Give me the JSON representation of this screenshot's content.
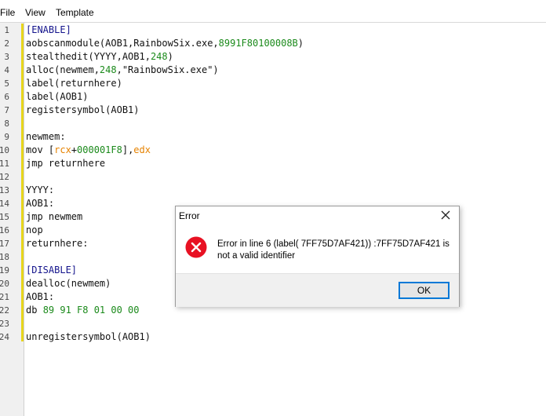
{
  "menu": {
    "file": "File",
    "view": "View",
    "template": "Template"
  },
  "editor": {
    "lines": [
      {
        "no": "1",
        "parts": [
          {
            "t": "[ENABLE]",
            "c": "sec"
          }
        ]
      },
      {
        "no": "2",
        "parts": [
          {
            "t": "aobscanmodule(AOB1,RainbowSix.exe,",
            "c": "kw"
          },
          {
            "t": "8991F80100008B",
            "c": "num"
          },
          {
            "t": ")",
            "c": "kw"
          }
        ]
      },
      {
        "no": "3",
        "parts": [
          {
            "t": "stealthedit(YYYY,AOB1,",
            "c": "kw"
          },
          {
            "t": "248",
            "c": "num"
          },
          {
            "t": ")",
            "c": "kw"
          }
        ]
      },
      {
        "no": "4",
        "parts": [
          {
            "t": "alloc(newmem,",
            "c": "kw"
          },
          {
            "t": "248",
            "c": "num"
          },
          {
            "t": ",\"RainbowSix.exe\")",
            "c": "str"
          }
        ]
      },
      {
        "no": "5",
        "parts": [
          {
            "t": "label(returnhere)",
            "c": "kw"
          }
        ]
      },
      {
        "no": "6",
        "parts": [
          {
            "t": "label(AOB1)",
            "c": "kw"
          }
        ]
      },
      {
        "no": "7",
        "parts": [
          {
            "t": "registersymbol(AOB1)",
            "c": "kw"
          }
        ]
      },
      {
        "no": "8",
        "parts": []
      },
      {
        "no": "9",
        "parts": [
          {
            "t": "newmem:",
            "c": "kw"
          }
        ]
      },
      {
        "no": "10",
        "parts": [
          {
            "t": "mov [",
            "c": "kw"
          },
          {
            "t": "rcx",
            "c": "reg"
          },
          {
            "t": "+",
            "c": "kw"
          },
          {
            "t": "000001F8",
            "c": "num"
          },
          {
            "t": "],",
            "c": "kw"
          },
          {
            "t": "edx",
            "c": "reg"
          }
        ]
      },
      {
        "no": "11",
        "parts": [
          {
            "t": "jmp returnhere",
            "c": "kw"
          }
        ]
      },
      {
        "no": "12",
        "parts": []
      },
      {
        "no": "13",
        "parts": [
          {
            "t": "YYYY:",
            "c": "kw"
          }
        ]
      },
      {
        "no": "14",
        "parts": [
          {
            "t": "AOB1:",
            "c": "kw"
          }
        ]
      },
      {
        "no": "15",
        "parts": [
          {
            "t": "jmp newmem",
            "c": "kw"
          }
        ]
      },
      {
        "no": "16",
        "parts": [
          {
            "t": "nop",
            "c": "kw"
          }
        ]
      },
      {
        "no": "17",
        "parts": [
          {
            "t": "returnhere:",
            "c": "kw"
          }
        ]
      },
      {
        "no": "18",
        "parts": []
      },
      {
        "no": "19",
        "parts": [
          {
            "t": "[DISABLE]",
            "c": "sec"
          }
        ]
      },
      {
        "no": "20",
        "parts": [
          {
            "t": "dealloc(newmem)",
            "c": "kw"
          }
        ]
      },
      {
        "no": "21",
        "parts": [
          {
            "t": "AOB1:",
            "c": "kw"
          }
        ]
      },
      {
        "no": "22",
        "parts": [
          {
            "t": "db ",
            "c": "kw"
          },
          {
            "t": "89 91 F8 01 00 00",
            "c": "num"
          }
        ]
      },
      {
        "no": "23",
        "parts": []
      },
      {
        "no": "24",
        "parts": [
          {
            "t": "unregistersymbol(AOB1)",
            "c": "kw"
          }
        ]
      }
    ]
  },
  "dialog": {
    "title": "Error",
    "message_line1": "Error in line 6 (label( 7FF75D7AF421)) :7FF75D7AF421 is",
    "message_line2": "not a valid identifier",
    "ok_label": "OK"
  },
  "colors": {
    "section": "#14148c",
    "number": "#1b8a1b",
    "register": "#e68200",
    "error_icon": "#e81123",
    "gutter_marker": "#e7d51d"
  }
}
